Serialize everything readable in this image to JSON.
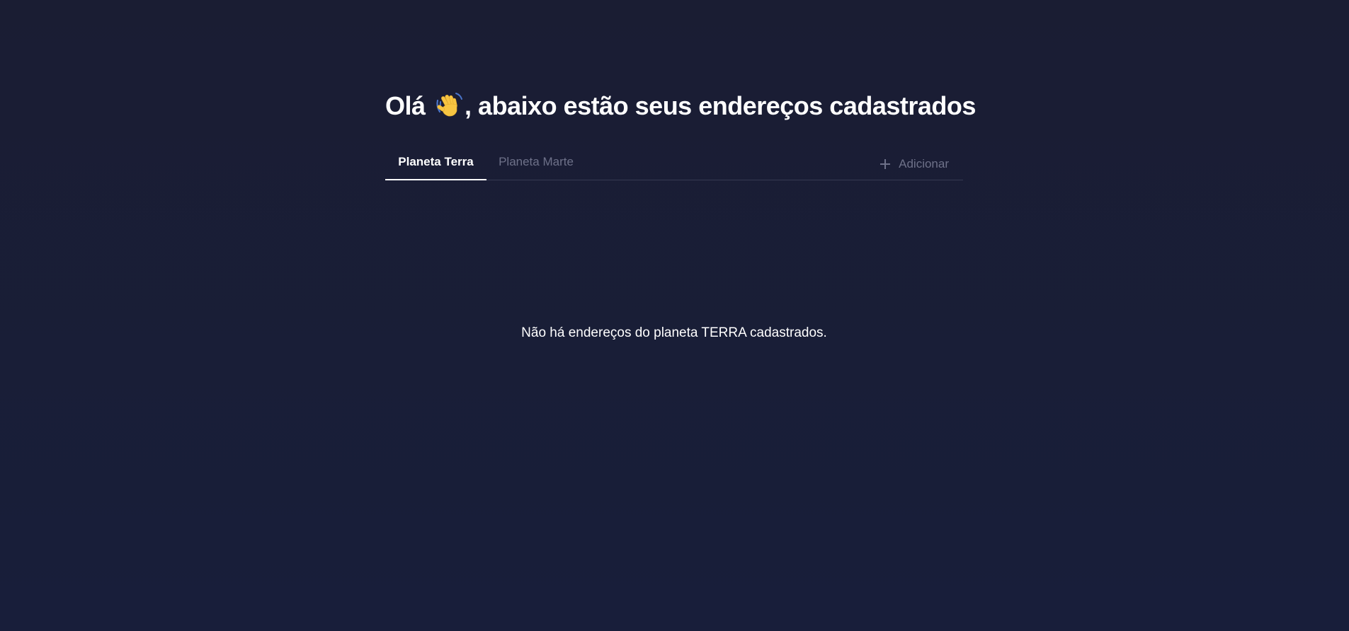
{
  "header": {
    "title_prefix": "Olá",
    "title_suffix": ", abaixo estão seus endereços cadastrados",
    "emoji_icon": "waving-hand-icon"
  },
  "tabs": [
    {
      "label": "Planeta Terra",
      "active": true
    },
    {
      "label": "Planeta Marte",
      "active": false
    }
  ],
  "actions": {
    "add_label": "Adicionar",
    "add_icon": "plus-icon"
  },
  "content": {
    "empty_message": "Não há endereços do planeta TERRA cadastrados."
  },
  "colors": {
    "background": "#1a1d33",
    "text_primary": "#ffffff",
    "text_muted": "#6e7189",
    "divider": "#363a52"
  }
}
